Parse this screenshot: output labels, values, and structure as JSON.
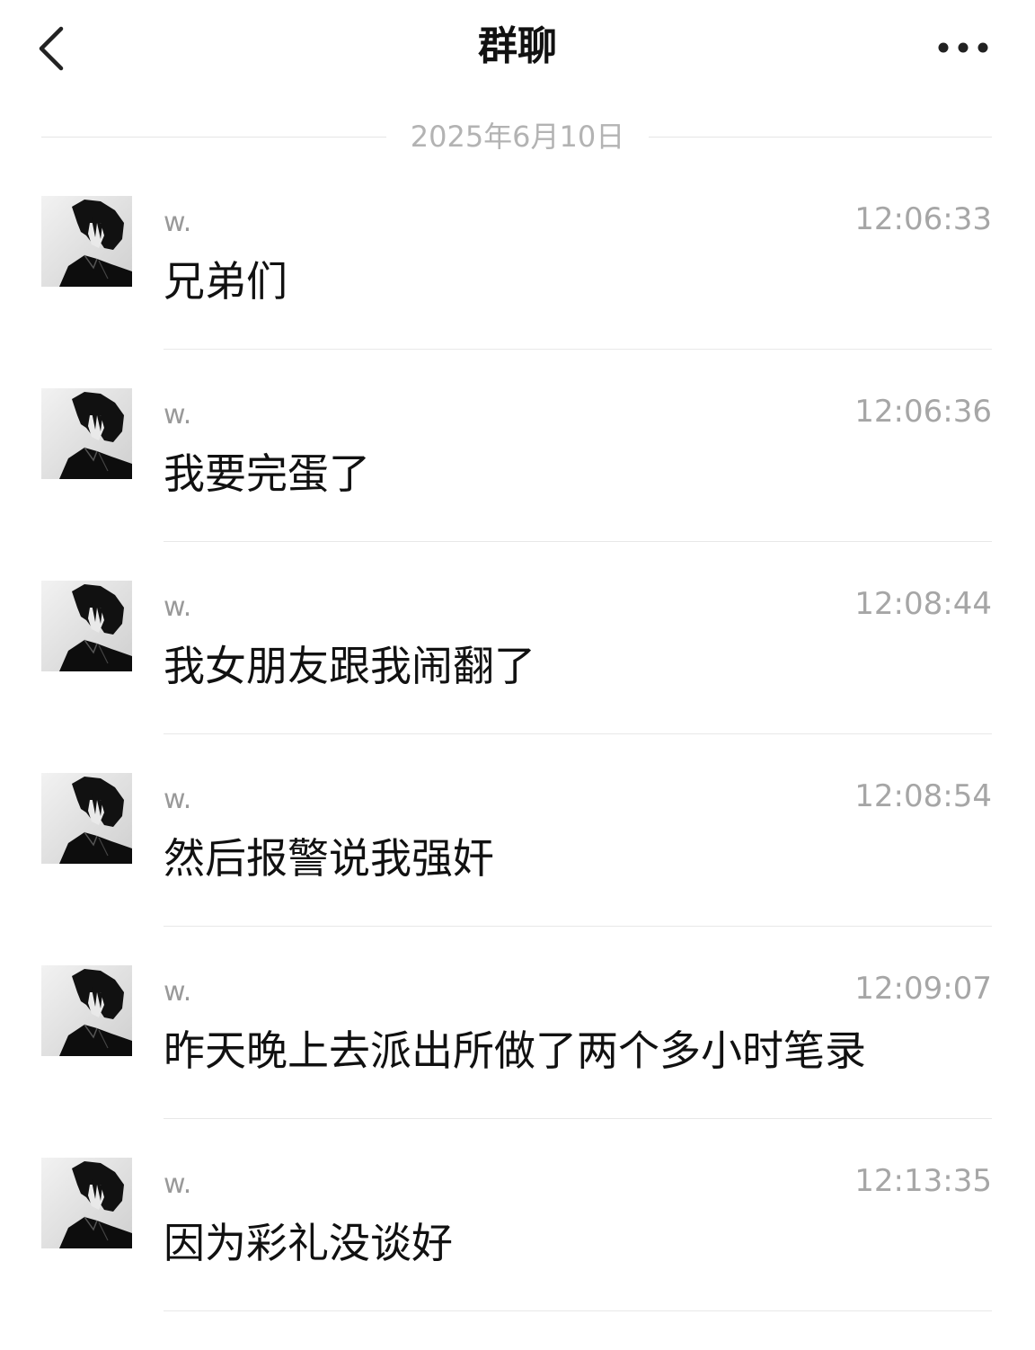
{
  "header": {
    "title": "群聊",
    "back_icon": "chevron-left-icon",
    "more_icon": "more-horizontal-icon"
  },
  "date_separator": "2025年6月10日",
  "messages": [
    {
      "sender": "w.",
      "time": "12:06:33",
      "text": "兄弟们"
    },
    {
      "sender": "w.",
      "time": "12:06:36",
      "text": "我要完蛋了"
    },
    {
      "sender": "w.",
      "time": "12:08:44",
      "text": "我女朋友跟我闹翻了"
    },
    {
      "sender": "w.",
      "time": "12:08:54",
      "text": "然后报警说我强奸"
    },
    {
      "sender": "w.",
      "time": "12:09:07",
      "text": "昨天晚上去派出所做了两个多小时笔录"
    },
    {
      "sender": "w.",
      "time": "12:13:35",
      "text": "因为彩礼没谈好"
    }
  ],
  "colors": {
    "background": "#ffffff",
    "text": "#111111",
    "muted": "#a6a6a6",
    "divider": "#e8e8e8"
  }
}
